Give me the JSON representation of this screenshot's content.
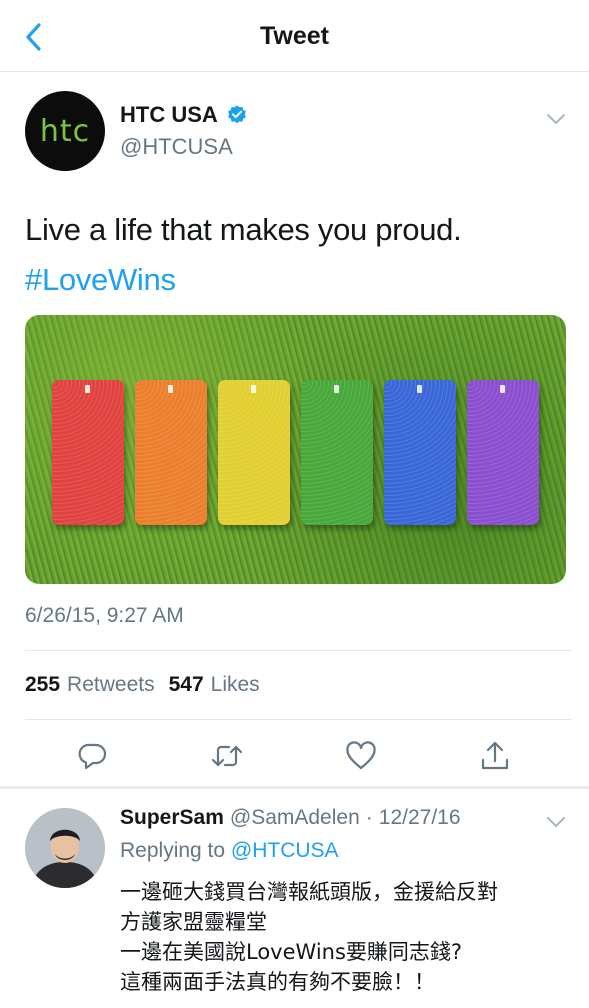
{
  "header": {
    "title": "Tweet"
  },
  "tweet": {
    "author_name": "HTC USA",
    "author_handle": "@HTCUSA",
    "avatar_text": "htc",
    "text": "Live a life that makes you proud.",
    "hashtag": "#LoveWins",
    "timestamp": "6/26/15, 9:27 AM",
    "retweets_count": "255",
    "retweets_label": "Retweets",
    "likes_count": "547",
    "likes_label": "Likes",
    "media_phone_colors": [
      "#e04340",
      "#ec7f2e",
      "#e2cf31",
      "#48a83c",
      "#3a67d8",
      "#8a4fcf"
    ]
  },
  "reply": {
    "name": "SuperSam",
    "handle": "@SamAdelen",
    "separator": "·",
    "date": "12/27/16",
    "replying_prefix": "Replying to",
    "replying_to": "@HTCUSA",
    "lines": [
      "一邊砸大錢買台灣報紙頭版，金援給反對",
      "方護家盟靈糧堂",
      "一邊在美國說LoveWins要賺同志錢?",
      "這種兩面手法真的有夠不要臉！！"
    ]
  },
  "icons": {
    "back": "chevron-left-icon",
    "verified": "verified-badge-icon",
    "caret": "chevron-down-icon",
    "reply": "reply-icon",
    "retweet": "retweet-icon",
    "like": "heart-icon",
    "share": "share-icon"
  },
  "colors": {
    "accent": "#1da1f2",
    "secondary_text": "#657786",
    "primary_text": "#14171a"
  }
}
